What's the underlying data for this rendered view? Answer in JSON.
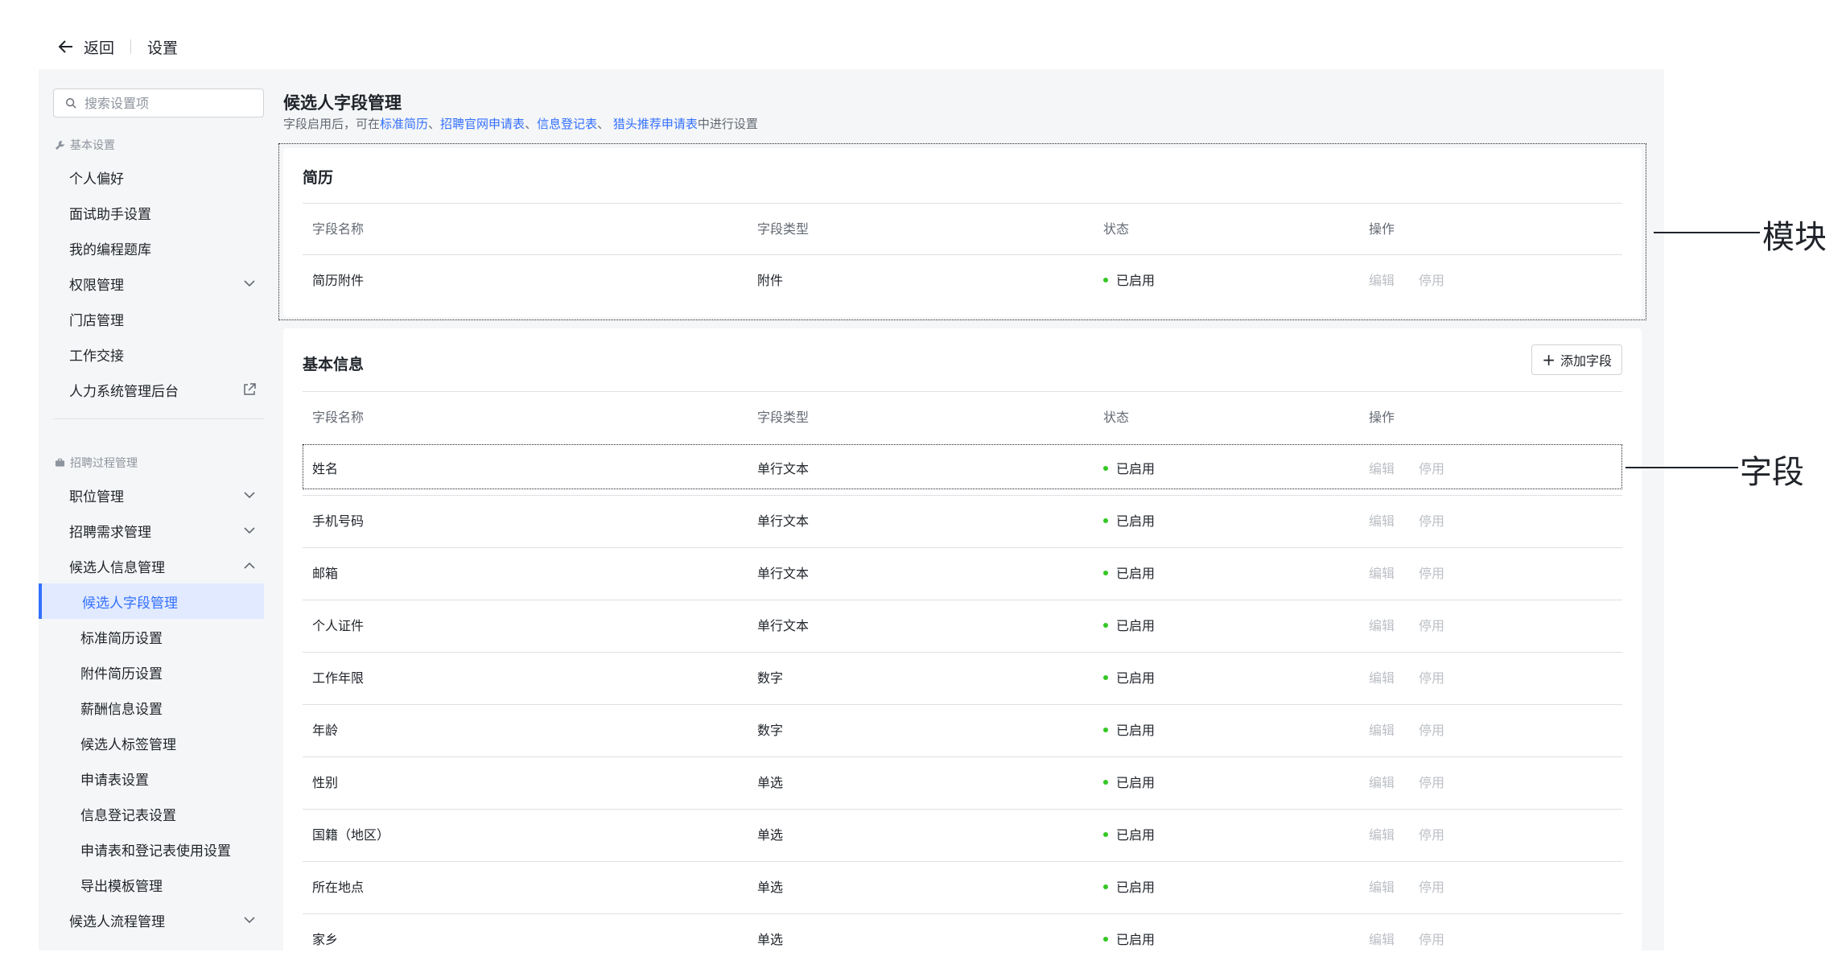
{
  "topbar": {
    "back_label": "返回",
    "title": "设置"
  },
  "sidebar": {
    "search_placeholder": "搜索设置项",
    "group1_title": "基本设置",
    "group1_items": [
      "个人偏好",
      "面试助手设置",
      "我的编程题库",
      "权限管理",
      "门店管理",
      "工作交接",
      "人力系统管理后台"
    ],
    "group2_title": "招聘过程管理",
    "group2_items": [
      "职位管理",
      "招聘需求管理",
      "候选人信息管理"
    ],
    "sub_items": [
      "候选人字段管理",
      "标准简历设置",
      "附件简历设置",
      "薪酬信息设置",
      "候选人标签管理",
      "申请表设置",
      "信息登记表设置",
      "申请表和登记表使用设置",
      "导出模板管理"
    ],
    "last_item": "候选人流程管理"
  },
  "page": {
    "title": "候选人字段管理",
    "desc_prefix": "字段启用后，可在",
    "links": [
      "标准简历",
      "招聘官网申请表",
      "信息登记表",
      "猎头推荐申请表"
    ],
    "sep1": "、",
    "sep2": "、",
    "sep3": "、 ",
    "desc_suffix": "中进行设置"
  },
  "table_headers": {
    "name": "字段名称",
    "type": "字段类型",
    "status": "状态",
    "ops": "操作"
  },
  "ops": {
    "edit": "编辑",
    "disable": "停用"
  },
  "resume_card": {
    "title": "简历",
    "rows": [
      {
        "name": "简历附件",
        "type": "附件",
        "status": "已启用"
      }
    ]
  },
  "basic_card": {
    "title": "基本信息",
    "add_label": "添加字段",
    "rows": [
      {
        "name": "姓名",
        "type": "单行文本",
        "status": "已启用"
      },
      {
        "name": "手机号码",
        "type": "单行文本",
        "status": "已启用"
      },
      {
        "name": "邮箱",
        "type": "单行文本",
        "status": "已启用"
      },
      {
        "name": "个人证件",
        "type": "单行文本",
        "status": "已启用"
      },
      {
        "name": "工作年限",
        "type": "数字",
        "status": "已启用"
      },
      {
        "name": "年龄",
        "type": "数字",
        "status": "已启用"
      },
      {
        "name": "性别",
        "type": "单选",
        "status": "已启用"
      },
      {
        "name": "国籍（地区）",
        "type": "单选",
        "status": "已启用"
      },
      {
        "name": "所在地点",
        "type": "单选",
        "status": "已启用"
      },
      {
        "name": "家乡",
        "type": "单选",
        "status": "已启用"
      }
    ]
  },
  "annotations": {
    "module": "模块",
    "field": "字段"
  },
  "colors": {
    "accent": "#3370ff",
    "status_green": "#34c724",
    "active_bg": "#e1eaff"
  }
}
